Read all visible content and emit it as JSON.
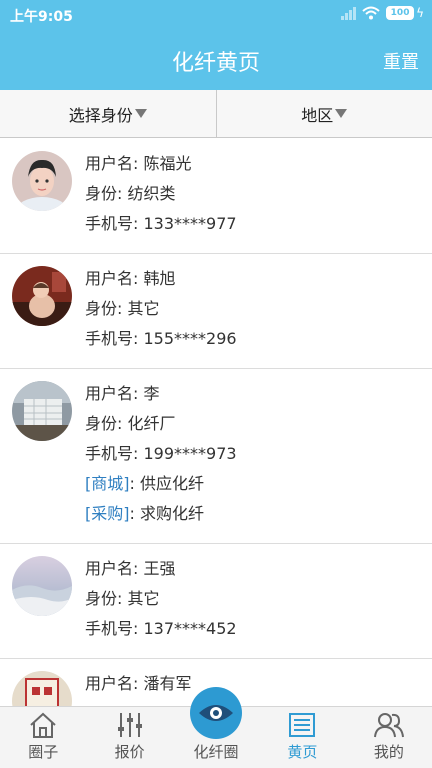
{
  "status_bar": {
    "time": "上午9:05",
    "battery": "100"
  },
  "header": {
    "title": "化纤黄页",
    "reset_label": "重置"
  },
  "filters": {
    "identity_label": "选择身份",
    "region_label": "地区"
  },
  "labels": {
    "username": "用户名: ",
    "identity": "身份: ",
    "phone": "手机号: "
  },
  "users": [
    {
      "name": "陈福光",
      "identity": "纺织类",
      "phone": "133****977"
    },
    {
      "name": "韩旭",
      "identity": "其它",
      "phone": "155****296"
    },
    {
      "name": "李",
      "identity": "化纤厂",
      "phone": "199****973",
      "shop_tag": "[商城]",
      "shop_text": ": 供应化纤",
      "purchase_tag": "[采购]",
      "purchase_text": ": 求购化纤"
    },
    {
      "name": "王强",
      "identity": "其它",
      "phone": "137****452"
    },
    {
      "name": "潘有军"
    }
  ],
  "tabs": [
    {
      "label": "圈子",
      "icon": "home-icon"
    },
    {
      "label": "报价",
      "icon": "sliders-icon"
    },
    {
      "label": "化纤圈",
      "icon": "eye-icon"
    },
    {
      "label": "黄页",
      "icon": "list-icon"
    },
    {
      "label": "我的",
      "icon": "users-icon"
    }
  ],
  "colors": {
    "primary": "#5cc3ea",
    "active_tab": "#2f9bd3",
    "tag": "#2f7fc1"
  }
}
